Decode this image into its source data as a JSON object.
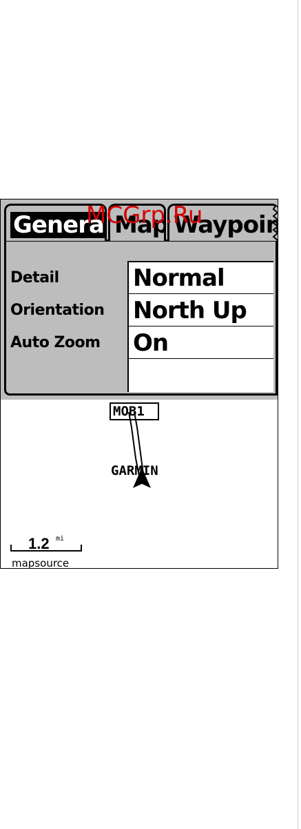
{
  "tabs": [
    {
      "label": "General",
      "selected": true
    },
    {
      "label": "Map",
      "selected": false
    },
    {
      "label": "Waypoin",
      "selected": false
    }
  ],
  "settings": [
    {
      "label": "Detail",
      "value": "Normal"
    },
    {
      "label": "Orientation",
      "value": "North Up"
    },
    {
      "label": "Auto Zoom",
      "value": "On"
    }
  ],
  "map": {
    "waypoint_label": "MOB1",
    "place_label": "GARMIN",
    "scale_value": "1.2",
    "scale_unit": "mi",
    "source_label": "mapsource",
    "cursor_icon": "arrow-position-icon"
  },
  "watermark": "MCGrp.Ru",
  "colors": {
    "panel": "#bdbdbd",
    "selected_tab": "#000000",
    "watermark": "#d50000"
  }
}
